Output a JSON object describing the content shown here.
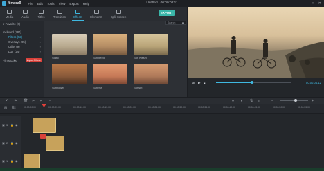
{
  "app": {
    "logo_text": "filmora9",
    "window_title": "Untitled : 00:00:08:11",
    "menu": [
      "File",
      "Edit",
      "Tools",
      "View",
      "Export",
      "Help"
    ]
  },
  "toolbar": {
    "tabs": [
      {
        "label": "Media"
      },
      {
        "label": "Audio"
      },
      {
        "label": "Titles"
      },
      {
        "label": "Transition"
      },
      {
        "label": "Effects"
      },
      {
        "label": "Elements"
      },
      {
        "label": "Split Screen"
      }
    ],
    "export_label": "EXPORT"
  },
  "sidebar": {
    "favorite": "♥ Favorite (0)",
    "included": "Included (280)",
    "items": [
      {
        "label": "Filters (52)"
      },
      {
        "label": "Overlays (95)"
      },
      {
        "label": "Utility (9)"
      },
      {
        "label": "LUT (24)"
      }
    ],
    "filmstocks": "Filmstocks",
    "red_tag": "Import Filters"
  },
  "search": {
    "placeholder": "Search"
  },
  "effects": [
    {
      "label": "Static",
      "color": "#c9b79c"
    },
    {
      "label": "Sunbleed",
      "color": "#b58d64"
    },
    {
      "label": "Sun Kissed",
      "color": "#b9a478"
    },
    {
      "label": "Sunflower",
      "color": "#8a5a3a"
    },
    {
      "label": "Sunrise",
      "color": "#c77a58"
    },
    {
      "label": "Sunset",
      "color": "#b07a5a"
    }
  ],
  "preview": {
    "timecode": "00:00:04:12",
    "progress": 0.48
  },
  "timeline": {
    "ticks": [
      "00:00:00:00",
      "00:00:05:00",
      "00:00:10:00",
      "00:00:15:00",
      "00:00:20:00",
      "00:00:25:00",
      "00:00:30:00",
      "00:00:35:00",
      "00:00:40:00",
      "00:00:45:00",
      "00:00:50:00",
      "00:00:55:00"
    ],
    "tracks": [
      {
        "num": "3"
      },
      {
        "num": "2"
      },
      {
        "num": "1"
      }
    ],
    "clip_color": "#c7a25b"
  }
}
